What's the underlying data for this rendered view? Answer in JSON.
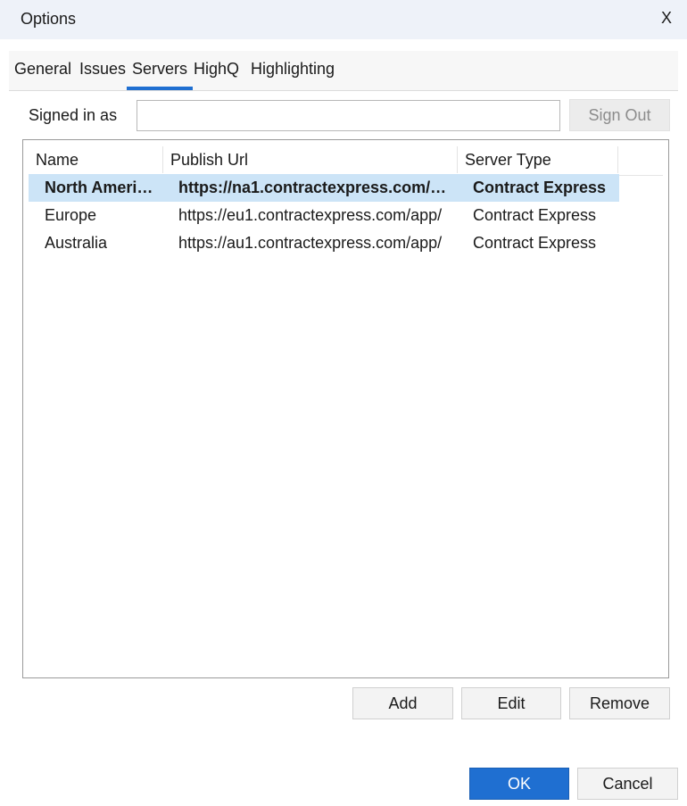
{
  "window": {
    "title": "Options",
    "close_label": "X"
  },
  "tabs": [
    {
      "label": "General"
    },
    {
      "label": "Issues"
    },
    {
      "label": "Servers",
      "active": true
    },
    {
      "label": "HighQ"
    },
    {
      "label": "Highlighting"
    }
  ],
  "signin": {
    "label": "Signed in as",
    "value": "",
    "sign_out_label": "Sign Out"
  },
  "table": {
    "columns": [
      "Name",
      "Publish Url",
      "Server Type"
    ],
    "rows": [
      {
        "name": "North Ameri…",
        "url": "https://na1.contractexpress.com/…",
        "type": "Contract Express",
        "selected": true
      },
      {
        "name": "Europe",
        "url": "https://eu1.contractexpress.com/app/",
        "type": "Contract Express",
        "selected": false
      },
      {
        "name": "Australia",
        "url": "https://au1.contractexpress.com/app/",
        "type": "Contract Express",
        "selected": false
      }
    ]
  },
  "actions": {
    "add": "Add",
    "edit": "Edit",
    "remove": "Remove"
  },
  "footer": {
    "ok": "OK",
    "cancel": "Cancel"
  },
  "colors": {
    "accent": "#1f6fd1",
    "selection": "#cce4f7",
    "titlebar": "#eef2f9"
  }
}
